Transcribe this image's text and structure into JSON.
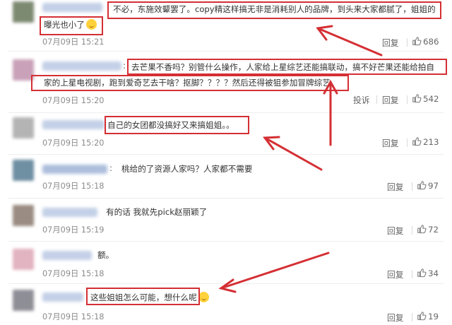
{
  "comments": [
    {
      "line1": "不必，东施效颦罢了。copy精这样搞无非是消耗别人的品牌，到头来大家都腻了，姐姐的",
      "line2": "曝光也小了",
      "timestamp": "07月09日 15:21",
      "reply": "回复",
      "likes": "686"
    },
    {
      "line1": "去芒果不香吗？别管什么操作，人家给上星综艺还能搞联动，搞不好芒果还能给拍自",
      "line2": "家的上星电视剧，跑到爱奇艺去干啥？抠脚？？？？然后还得被狙参加冒牌综艺",
      "timestamp": "07月09日 15:20",
      "report": "投诉",
      "reply": "回复",
      "likes": "542"
    },
    {
      "line1": "自己的女团都没搞好又来搞姐姐。。",
      "timestamp": "07月09日 15:20",
      "reply": "回复",
      "likes": "213"
    },
    {
      "line1": "桃给的了资源人家吗？人家都不需要",
      "timestamp": "07月09日 15:18",
      "reply": "回复",
      "likes": "97"
    },
    {
      "line1": "有的话 我就先pick赵丽颖了",
      "timestamp": "07月09日 15:19",
      "reply": "回复",
      "likes": "72"
    },
    {
      "line1": "额。",
      "timestamp": "07月09日 15:18",
      "reply": "回复",
      "likes": "34"
    },
    {
      "line1": "这些姐姐怎么可能，想什么呢",
      "timestamp": "07月09日 15:18",
      "reply": "回复",
      "likes": "19"
    }
  ],
  "icons": {
    "like": "thumbs-up-icon",
    "emoji": "smile-emoji-icon"
  },
  "colors": {
    "annotation": "#d42f34",
    "name_blur": "#b9c8e3",
    "text": "#333333",
    "meta": "#8c8c8c"
  }
}
